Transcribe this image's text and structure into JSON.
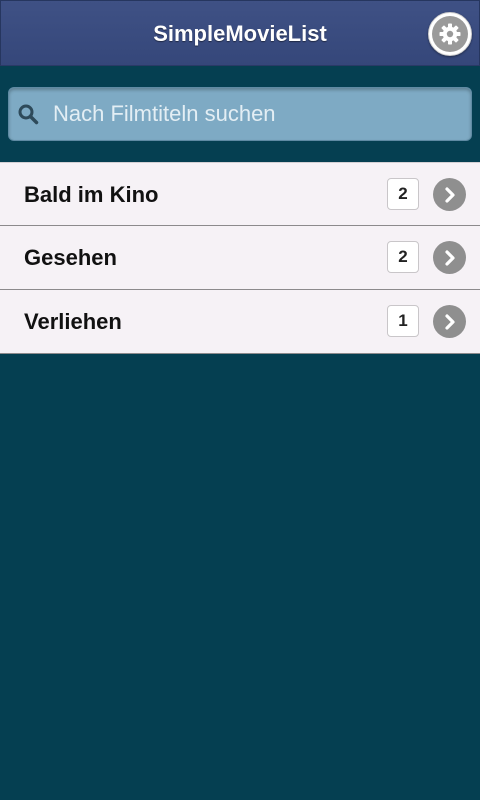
{
  "header": {
    "title": "SimpleMovieList",
    "settings_icon": "gear-icon"
  },
  "search": {
    "placeholder": "Nach Filmtiteln suchen",
    "value": "",
    "icon": "search-icon"
  },
  "list": {
    "items": [
      {
        "label": "Bald im Kino",
        "count": "2",
        "icon": "chevron-right-icon"
      },
      {
        "label": "Gesehen",
        "count": "2",
        "icon": "chevron-right-icon"
      },
      {
        "label": "Verliehen",
        "count": "1",
        "icon": "chevron-right-icon"
      }
    ]
  },
  "colors": {
    "header_background": "#3b4d80",
    "page_background": "#053f51",
    "search_background": "#7eaac4",
    "list_background": "#f6f2f6",
    "chevron": "#8f8f8f"
  }
}
